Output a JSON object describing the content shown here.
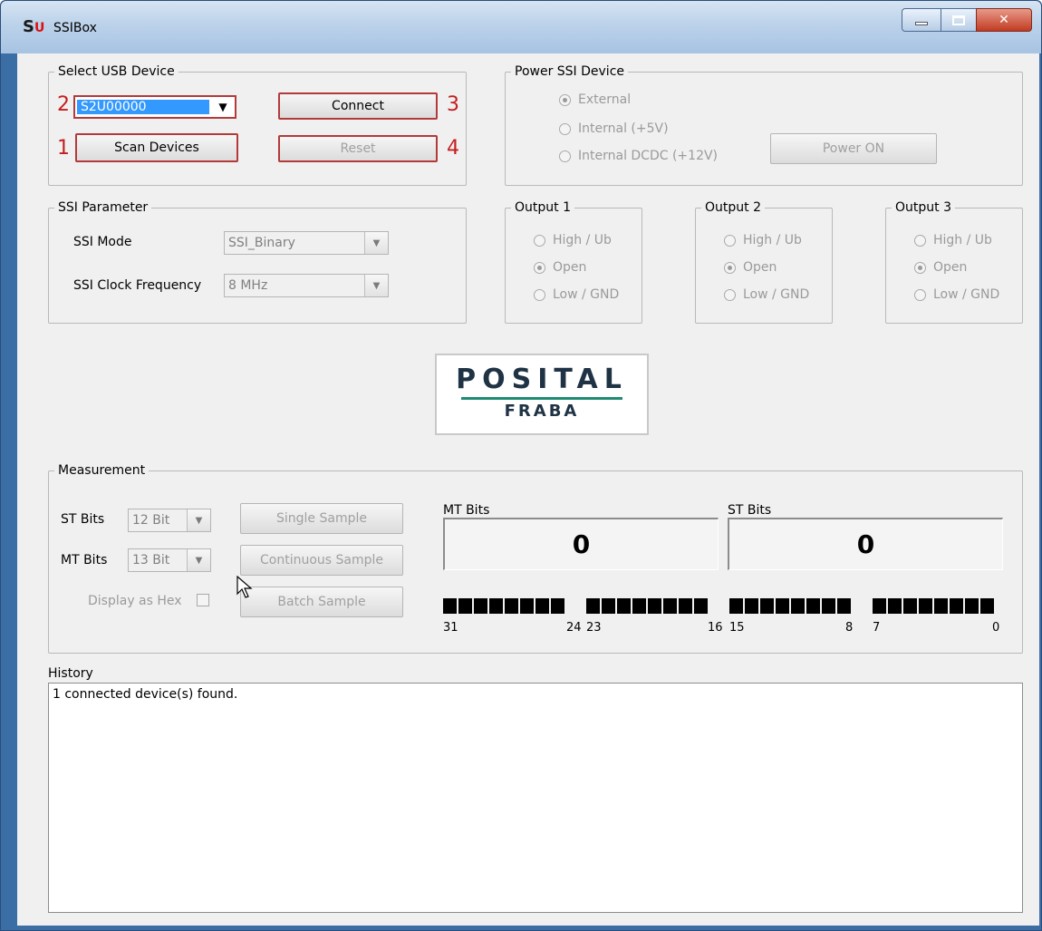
{
  "window": {
    "title": "SSIBox",
    "icon_letters": [
      "S",
      "U"
    ]
  },
  "usb": {
    "legend": "Select USB Device",
    "device_selected": "S2U00000",
    "connect_label": "Connect",
    "scan_label": "Scan Devices",
    "reset_label": "Reset",
    "markers": {
      "combo": "2",
      "connect": "3",
      "scan": "1",
      "reset": "4"
    }
  },
  "power": {
    "legend": "Power SSI Device",
    "options": [
      "External",
      "Internal (+5V)",
      "Internal DCDC (+12V)"
    ],
    "selected": "External",
    "power_button": "Power ON"
  },
  "ssi": {
    "legend": "SSI Parameter",
    "mode_label": "SSI Mode",
    "mode_value": "SSI_Binary",
    "clock_label": "SSI Clock Frequency",
    "clock_value": "8 MHz"
  },
  "outputs": [
    {
      "legend": "Output 1",
      "options": [
        "High / Ub",
        "Open",
        "Low / GND"
      ],
      "selected": "Open"
    },
    {
      "legend": "Output 2",
      "options": [
        "High / Ub",
        "Open",
        "Low / GND"
      ],
      "selected": "Open"
    },
    {
      "legend": "Output 3",
      "options": [
        "High / Ub",
        "Open",
        "Low / GND"
      ],
      "selected": "Open"
    }
  ],
  "logo": {
    "brand": "POSITAL",
    "sub": "FRABA"
  },
  "measurement": {
    "legend": "Measurement",
    "st_bits_label": "ST Bits",
    "st_bits_value": "12 Bit",
    "mt_bits_label": "MT Bits",
    "mt_bits_value": "13 Bit",
    "hex_label": "Display as Hex",
    "single_label": "Single Sample",
    "continuous_label": "Continuous Sample",
    "batch_label": "Batch Sample",
    "mt_display_label": "MT Bits",
    "mt_display_value": "0",
    "st_display_label": "ST Bits",
    "st_display_value": "0",
    "bit_labels": [
      "31",
      "24",
      "23",
      "16",
      "15",
      "8",
      "7",
      "0"
    ]
  },
  "history": {
    "label": "History",
    "lines": [
      "1 connected device(s) found."
    ]
  }
}
